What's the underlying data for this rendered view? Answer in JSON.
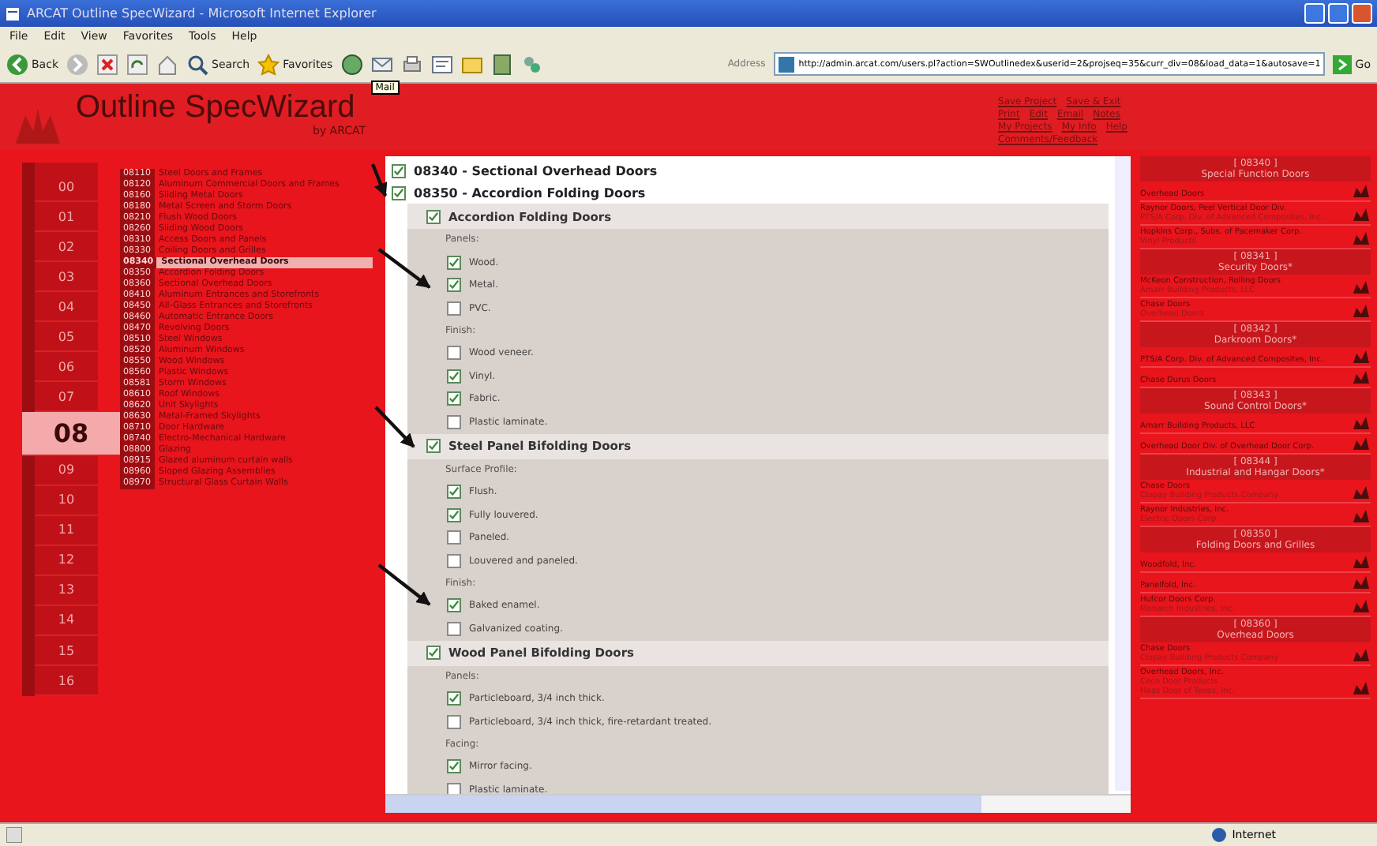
{
  "window": {
    "title": "ARCAT Outline SpecWizard - Microsoft Internet Explorer"
  },
  "menu": [
    "File",
    "Edit",
    "View",
    "Favorites",
    "Tools",
    "Help"
  ],
  "toolbar": {
    "back": "Back",
    "search": "Search",
    "favorites": "Favorites",
    "tooltip": "Mail",
    "address_label": "Address",
    "address": "http://admin.arcat.com/users.pl?action=SWOutlinedex&userid=2&projseq=35&curr_div=08&load_data=1&autosave=1",
    "go": "Go"
  },
  "header": {
    "title": "Outline SpecWizard",
    "byline": "by ARCAT",
    "links": [
      [
        "Save Project",
        "Save & Exit"
      ],
      [
        "Print",
        "Edit",
        "Email",
        "Notes"
      ],
      [
        "My Projects",
        "My Info",
        "Help"
      ],
      [
        "Comments/Feedback"
      ]
    ]
  },
  "divisions": [
    {
      "label": "00",
      "selected": false
    },
    {
      "label": "01",
      "selected": false
    },
    {
      "label": "02",
      "selected": false
    },
    {
      "label": "03",
      "selected": false
    },
    {
      "label": "04",
      "selected": false
    },
    {
      "label": "05",
      "selected": false
    },
    {
      "label": "06",
      "selected": false
    },
    {
      "label": "07",
      "selected": false
    },
    {
      "label": "08",
      "selected": true
    },
    {
      "label": "09",
      "selected": false
    },
    {
      "label": "10",
      "selected": false
    },
    {
      "label": "11",
      "selected": false
    },
    {
      "label": "12",
      "selected": false
    },
    {
      "label": "13",
      "selected": false
    },
    {
      "label": "14",
      "selected": false
    },
    {
      "label": "15",
      "selected": false
    },
    {
      "label": "16",
      "selected": false
    }
  ],
  "sections": [
    {
      "code": "08110",
      "title": "Steel Doors and Frames",
      "selected": false
    },
    {
      "code": "08120",
      "title": "Aluminum Commercial Doors and Frames",
      "selected": false
    },
    {
      "code": "08160",
      "title": "Sliding Metal Doors",
      "selected": false
    },
    {
      "code": "08180",
      "title": "Metal Screen and Storm Doors",
      "selected": false
    },
    {
      "code": "08210",
      "title": "Flush Wood Doors",
      "selected": false
    },
    {
      "code": "08260",
      "title": "Sliding Wood Doors",
      "selected": false
    },
    {
      "code": "08310",
      "title": "Access Doors and Panels",
      "selected": false
    },
    {
      "code": "08330",
      "title": "Coiling Doors and Grilles",
      "selected": false
    },
    {
      "code": "08340",
      "title": "Sectional Overhead Doors",
      "selected": true
    },
    {
      "code": "08350",
      "title": "Accordion Folding Doors",
      "selected": false
    },
    {
      "code": "08360",
      "title": "Sectional Overhead Doors",
      "selected": false
    },
    {
      "code": "08410",
      "title": "Aluminum Entrances and Storefronts",
      "selected": false
    },
    {
      "code": "08450",
      "title": "All-Glass Entrances and Storefronts",
      "selected": false
    },
    {
      "code": "08460",
      "title": "Automatic Entrance Doors",
      "selected": false
    },
    {
      "code": "08470",
      "title": "Revolving Doors",
      "selected": false
    },
    {
      "code": "08510",
      "title": "Steel Windows",
      "selected": false
    },
    {
      "code": "08520",
      "title": "Aluminum Windows",
      "selected": false
    },
    {
      "code": "08550",
      "title": "Wood Windows",
      "selected": false
    },
    {
      "code": "08560",
      "title": "Plastic Windows",
      "selected": false
    },
    {
      "code": "08581",
      "title": "Storm Windows",
      "selected": false
    },
    {
      "code": "08610",
      "title": "Roof Windows",
      "selected": false
    },
    {
      "code": "08620",
      "title": "Unit Skylights",
      "selected": false
    },
    {
      "code": "08630",
      "title": "Metal-Framed Skylights",
      "selected": false
    },
    {
      "code": "08710",
      "title": "Door Hardware",
      "selected": false
    },
    {
      "code": "08740",
      "title": "Electro-Mechanical Hardware",
      "selected": false
    },
    {
      "code": "08800",
      "title": "Glazing",
      "selected": false
    },
    {
      "code": "08915",
      "title": "Glazed aluminum curtain walls",
      "selected": false
    },
    {
      "code": "08960",
      "title": "Sloped Glazing Assemblies",
      "selected": false
    },
    {
      "code": "08970",
      "title": "Structural Glass Curtain Walls",
      "selected": false
    }
  ],
  "outline": [
    {
      "title": "08340 - Sectional Overhead Doors",
      "checked": true
    },
    {
      "title": "08350 - Accordion Folding Doors",
      "checked": true,
      "children": [
        {
          "title": "Accordion Folding Doors",
          "checked": true,
          "groups": [
            {
              "label": "Panels:",
              "options": [
                {
                  "label": "Wood.",
                  "checked": true
                },
                {
                  "label": "Metal.",
                  "checked": true
                },
                {
                  "label": "PVC.",
                  "checked": false
                }
              ]
            },
            {
              "label": "Finish:",
              "options": [
                {
                  "label": "Wood veneer.",
                  "checked": false
                },
                {
                  "label": "Vinyl.",
                  "checked": true
                },
                {
                  "label": "Fabric.",
                  "checked": true
                },
                {
                  "label": "Plastic laminate.",
                  "checked": false
                }
              ]
            }
          ]
        },
        {
          "title": "Steel Panel Bifolding Doors",
          "checked": true,
          "groups": [
            {
              "label": "Surface Profile:",
              "options": [
                {
                  "label": "Flush.",
                  "checked": true
                },
                {
                  "label": "Fully louvered.",
                  "checked": true
                },
                {
                  "label": "Paneled.",
                  "checked": false
                },
                {
                  "label": "Louvered and paneled.",
                  "checked": false
                }
              ]
            },
            {
              "label": "Finish:",
              "options": [
                {
                  "label": "Baked enamel.",
                  "checked": true
                },
                {
                  "label": "Galvanized coating.",
                  "checked": false
                }
              ]
            }
          ]
        },
        {
          "title": "Wood Panel Bifolding Doors",
          "checked": true,
          "groups": [
            {
              "label": "Panels:",
              "options": [
                {
                  "label": "Particleboard, 3/4 inch thick.",
                  "checked": true
                },
                {
                  "label": "Particleboard, 3/4 inch thick, fire-retardant treated.",
                  "checked": false
                }
              ]
            },
            {
              "label": "Facing:",
              "options": [
                {
                  "label": "Mirror facing.",
                  "checked": true
                },
                {
                  "label": "Plastic laminate.",
                  "checked": false
                }
              ]
            }
          ]
        }
      ]
    }
  ],
  "manufacturers": [
    {
      "code": "[ 08340 ]",
      "title": "Special Function Doors",
      "items": [
        [
          "Overhead Doors"
        ],
        [
          "Raynor Doors, Peel Vertical Door Div.",
          "PTS/A Corp. Div. of Advanced Composites, Inc."
        ],
        [
          "Hopkins Corp., Subs. of Pacemaker Corp.",
          "Vinyl Products"
        ]
      ]
    },
    {
      "code": "[ 08341 ]",
      "title": "Security Doors*",
      "items": [
        [
          "McKeon Construction, Rolling Doors",
          "Amarr Building Products, LLC"
        ],
        [
          "Chase Doors",
          "Overhead Doors"
        ]
      ]
    },
    {
      "code": "[ 08342 ]",
      "title": "Darkroom Doors*",
      "items": [
        [
          "PTS/A Corp. Div. of Advanced Composites, Inc."
        ],
        [
          "Chase Durus Doors"
        ]
      ]
    },
    {
      "code": "[ 08343 ]",
      "title": "Sound Control Doors*",
      "items": [
        [
          "Amarr Building Products, LLC"
        ],
        [
          "Overhead Door Div. of Overhead Door Corp."
        ]
      ]
    },
    {
      "code": "[ 08344 ]",
      "title": "Industrial and Hangar Doors*",
      "items": [
        [
          "Chase Doors",
          "Clopay Building Products Company"
        ],
        [
          "Raynor Industries, Inc.",
          "Electric Doors Corp."
        ]
      ]
    },
    {
      "code": "[ 08350 ]",
      "title": "Folding Doors and Grilles",
      "items": [
        [
          "Woodfold, Inc."
        ],
        [
          "Panelfold, Inc."
        ],
        [
          "Hufcor Doors Corp.",
          "Monarch Industries, Inc."
        ]
      ]
    },
    {
      "code": "[ 08360 ]",
      "title": "Overhead Doors",
      "items": [
        [
          "Chase Doors",
          "Clopay Building Products Company"
        ],
        [
          "Overhead Doors, Inc.",
          "Ceco Door Products",
          "Haas Door of Texas, Inc."
        ]
      ]
    }
  ],
  "status_bar": {
    "zone": "Internet"
  }
}
